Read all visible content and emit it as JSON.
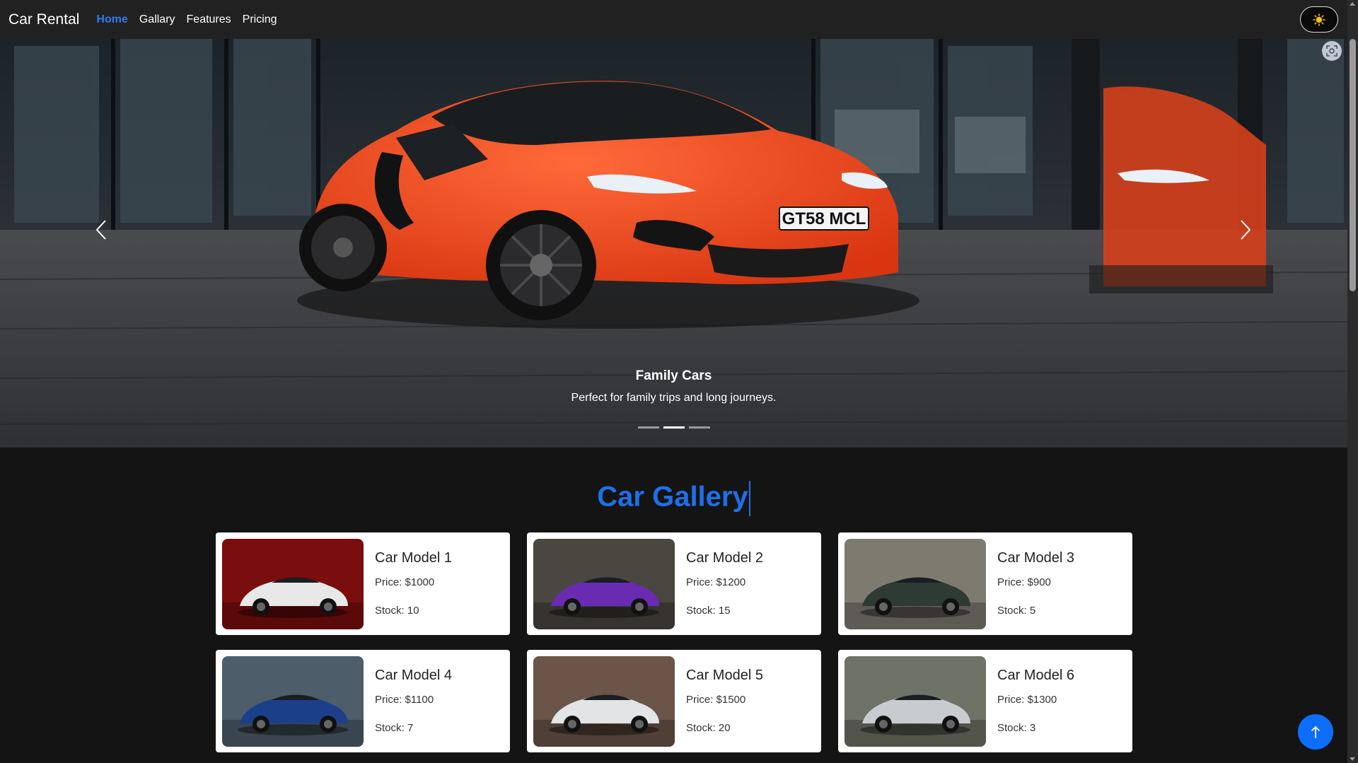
{
  "navbar": {
    "brand": "Car Rental",
    "links": [
      {
        "label": "Home",
        "active": true
      },
      {
        "label": "Gallary",
        "active": false
      },
      {
        "label": "Features",
        "active": false
      },
      {
        "label": "Pricing",
        "active": false
      }
    ],
    "theme_icon": "sun-icon"
  },
  "hero": {
    "slide_title": "Family Cars",
    "slide_text": "Perfect for family trips and long journeys.",
    "plate_text": "GT58 MCL",
    "slide_count": 3,
    "active_slide": 2,
    "prev_icon": "chevron-left-icon",
    "next_icon": "chevron-right-icon"
  },
  "gallery": {
    "title": "Car Gallery",
    "cards": [
      {
        "name": "Car Model 1",
        "price": "Price: $1000",
        "stock": "Stock: 10",
        "car_color": "#e8e8e8",
        "bg": "#7a0d0d"
      },
      {
        "name": "Car Model 2",
        "price": "Price: $1200",
        "stock": "Stock: 15",
        "car_color": "#6a2bb3",
        "bg": "#4a4640"
      },
      {
        "name": "Car Model 3",
        "price": "Price: $900",
        "stock": "Stock: 5",
        "car_color": "#2d3b34",
        "bg": "#7d7a70"
      },
      {
        "name": "Car Model 4",
        "price": "Price: $1100",
        "stock": "Stock: 7",
        "car_color": "#1c3f8a",
        "bg": "#4d5d6a"
      },
      {
        "name": "Car Model 5",
        "price": "Price: $1500",
        "stock": "Stock: 20",
        "car_color": "#e2e4e6",
        "bg": "#6b5448"
      },
      {
        "name": "Car Model 6",
        "price": "Price: $1300",
        "stock": "Stock: 3",
        "car_color": "#c8cbd0",
        "bg": "#6f7266"
      }
    ]
  },
  "colors": {
    "accent": "#1f6fe8",
    "hero_car": "#ff4a1c",
    "navbar_bg": "#212121",
    "page_bg": "#141414"
  },
  "scroll_to_top_icon": "arrow-up-icon"
}
